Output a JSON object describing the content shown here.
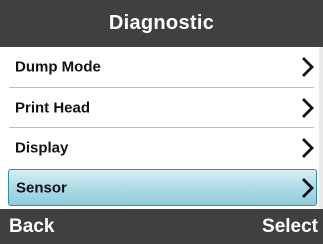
{
  "header": {
    "title": "Diagnostic"
  },
  "menu": {
    "items": [
      {
        "label": "Dump Mode",
        "icon": "chevron-right-icon",
        "selected": false
      },
      {
        "label": "Print Head",
        "icon": "chevron-right-icon",
        "selected": false
      },
      {
        "label": "Display",
        "icon": "chevron-right-icon",
        "selected": false
      },
      {
        "label": "Sensor",
        "icon": "chevron-right-icon",
        "selected": true
      }
    ]
  },
  "softkeys": {
    "left_label": "Back",
    "right_label": "Select"
  },
  "colors": {
    "bar_background": "#404040",
    "bar_text": "#ffffff",
    "selection_fill": "#a8d8e4",
    "selection_border": "#2e8fb0",
    "divider": "#bdbdbd"
  }
}
